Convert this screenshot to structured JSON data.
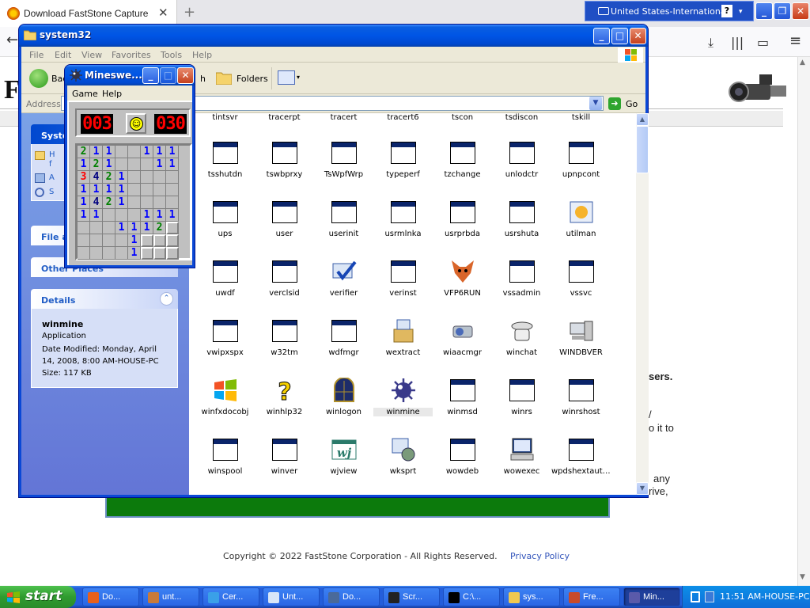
{
  "browser": {
    "tab_title": "Download FastStone Capture",
    "tab_close": "✕",
    "new_tab": "+",
    "nav_back": "←",
    "nav_download": "⤓",
    "nav_library": "|||",
    "nav_sidebar": "▭",
    "nav_menu": "≡",
    "logo_letter": "F",
    "fragments": [
      "sers.",
      "/",
      "o it to",
      "any",
      "rive,"
    ],
    "copyright": "Copyright © 2022 FastStone Corporation - All Rights Reserved.",
    "privacy": "Privacy Policy"
  },
  "langbar": {
    "label": "United States-International",
    "help": "?",
    "options": "▾"
  },
  "top_buttons": {
    "min": "_",
    "restore": "❐",
    "close": "✕"
  },
  "explorer": {
    "title": "system32",
    "menu": [
      "File",
      "Edit",
      "View",
      "Favorites",
      "Tools",
      "Help"
    ],
    "toolbar": {
      "back": "Bac",
      "search": "h",
      "folders": "Folders"
    },
    "address_label": "Address",
    "go_label": "Go",
    "side": {
      "system_tasks": "Syste",
      "sys_items": [
        "H",
        "f",
        "A",
        "S"
      ],
      "file_and": "File a",
      "other_places": "Other Places",
      "details": {
        "header": "Details",
        "name": "winmine",
        "type": "Application",
        "modified": "Date Modified: Monday, April 14, 2008, 8:00 AM-HOUSE-PC",
        "size": "Size: 117 KB"
      }
    },
    "top_row": [
      "tintsvr",
      "tracerpt",
      "tracert",
      "tracert6",
      "tscon",
      "tsdiscon",
      "tskill"
    ],
    "files": [
      [
        "tsshutdn",
        "tswbprxy",
        "TsWpfWrp",
        "typeperf",
        "tzchange",
        "unlodctr",
        "upnpcont"
      ],
      [
        "ups",
        "user",
        "userinit",
        "usrmlnka",
        "usrprbda",
        "usrshuta",
        "utilman"
      ],
      [
        "uwdf",
        "verclsid",
        "verifier",
        "verinst",
        "VFP6RUN",
        "vssadmin",
        "vssvc"
      ],
      [
        "vwipxspx",
        "w32tm",
        "wdfmgr",
        "wextract",
        "wiaacmgr",
        "winchat",
        "WINDBVER"
      ],
      [
        "winfxdocobj",
        "winhlp32",
        "winlogon",
        "winmine",
        "winmsd",
        "winrs",
        "winrshost"
      ],
      [
        "winspool",
        "winver",
        "wjview",
        "wksprt",
        "wowdeb",
        "wowexec",
        "wpdshextautoplay"
      ]
    ],
    "file_icons": [
      [
        "app",
        "app",
        "app",
        "app",
        "app",
        "app",
        "app"
      ],
      [
        "app",
        "app",
        "app",
        "app",
        "app",
        "app",
        "utilman"
      ],
      [
        "app",
        "app",
        "verifier",
        "app",
        "fox",
        "app",
        "app"
      ],
      [
        "app",
        "app",
        "app",
        "wextract",
        "camera",
        "phone",
        "computer"
      ],
      [
        "winflag",
        "help",
        "winlogon",
        "mine",
        "app",
        "app",
        "app"
      ],
      [
        "app",
        "app",
        "wj",
        "wksprt",
        "app",
        "monitor",
        "app"
      ]
    ],
    "selected": "winmine"
  },
  "minesweeper": {
    "title": "Mineswe...",
    "menu": [
      "Game",
      "Help"
    ],
    "mines_left": "003",
    "timer": "030",
    "face": "☺",
    "grid": [
      "211..111",
      "121...11",
      "3421....",
      "1111....",
      "1421....",
      "11...111",
      "...1112#",
      "....1###",
      "....1###"
    ]
  },
  "taskbar": {
    "start": "start",
    "buttons": [
      {
        "label": "Do...",
        "color": "#e8601c"
      },
      {
        "label": "unt...",
        "color": "#c87a3a"
      },
      {
        "label": "Cer...",
        "color": "#3aa0e8"
      },
      {
        "label": "Unt...",
        "color": "#d8e6f8"
      },
      {
        "label": "Do...",
        "color": "#4a6a9a"
      },
      {
        "label": "Scr...",
        "color": "#222222"
      },
      {
        "label": "C:\\...",
        "color": "#000000"
      },
      {
        "label": "sys...",
        "color": "#f0c850"
      },
      {
        "label": "Fre...",
        "color": "#c84a2a"
      },
      {
        "label": "Min...",
        "color": "#5a5aaa"
      }
    ],
    "active_index": 9,
    "clock": "11:51 AM-HOUSE-PC"
  }
}
